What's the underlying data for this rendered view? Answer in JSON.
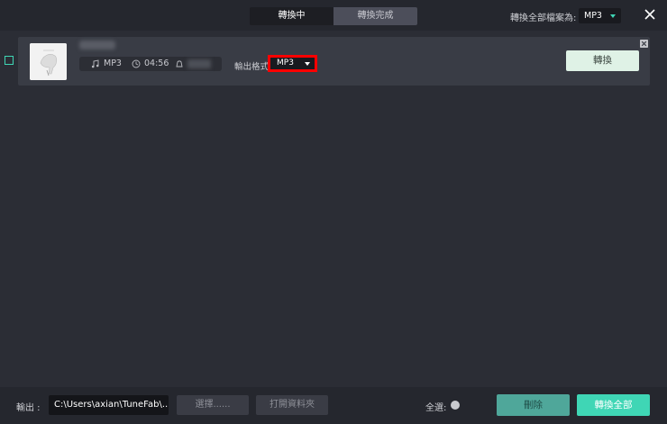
{
  "header": {
    "tabs": [
      {
        "label": "轉換中",
        "active": true
      },
      {
        "label": "轉換完成",
        "active": false
      }
    ],
    "convert_all_label": "轉換全部檔案為:",
    "convert_all_format": "MP3",
    "close_icon": "close-icon"
  },
  "track": {
    "format": "MP3",
    "duration": "04:56",
    "output_format_label": "輸出格式:",
    "output_format": "MP3",
    "convert_label": "轉換",
    "icons": [
      "music-note-icon",
      "clock-icon",
      "bell-icon",
      "remove-icon"
    ]
  },
  "footer": {
    "output_label": "輸出 :",
    "output_path": "C:\\Users\\axian\\TuneFab\\...",
    "choose_label": "選擇......",
    "open_folder_label": "打開資料夾",
    "select_all_label": "全選:",
    "delete_label": "刪除",
    "convert_all_label": "轉換全部"
  },
  "colors": {
    "accent": "#3fd6b5",
    "background": "#2b2d35",
    "bar": "#25272e",
    "row": "#393c45",
    "highlight": "#ff0000"
  }
}
